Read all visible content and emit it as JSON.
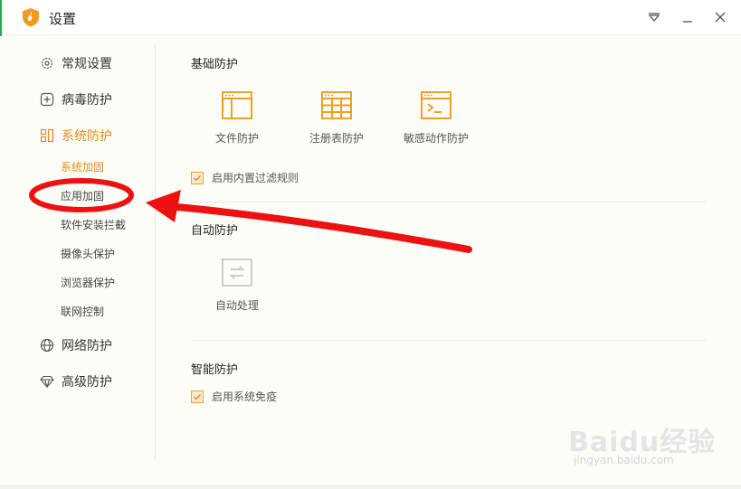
{
  "window": {
    "title": "设置"
  },
  "sidebar": {
    "items": [
      {
        "label": "常规设置",
        "icon": "gear-icon"
      },
      {
        "label": "病毒防护",
        "icon": "plus-square-icon"
      },
      {
        "label": "系统防护",
        "icon": "system-grid-icon",
        "active": true
      },
      {
        "label": "网络防护",
        "icon": "globe-icon"
      },
      {
        "label": "高级防护",
        "icon": "diamond-icon"
      }
    ],
    "subitems": [
      {
        "label": "系统加固",
        "active": true
      },
      {
        "label": "应用加固"
      },
      {
        "label": "软件安装拦截"
      },
      {
        "label": "摄像头保护"
      },
      {
        "label": "浏览器保护"
      },
      {
        "label": "联网控制"
      }
    ]
  },
  "main": {
    "basic": {
      "title": "基础防护",
      "features": [
        {
          "label": "文件防护",
          "icon": "file-window-icon"
        },
        {
          "label": "注册表防护",
          "icon": "registry-grid-icon"
        },
        {
          "label": "敏感动作防护",
          "icon": "terminal-icon"
        }
      ],
      "checkbox_label": "启用内置过滤规则",
      "checked": true
    },
    "auto": {
      "title": "自动防护",
      "features": [
        {
          "label": "自动处理",
          "icon": "auto-process-icon"
        }
      ]
    },
    "smart": {
      "title": "智能防护",
      "checkbox_label": "启用系统免疫",
      "checked": true
    }
  },
  "watermark": {
    "brand": "Baidu经验",
    "url": "jingyan.baidu.com"
  },
  "colors": {
    "accent": "#e8891a",
    "annotation": "#ee1111"
  }
}
